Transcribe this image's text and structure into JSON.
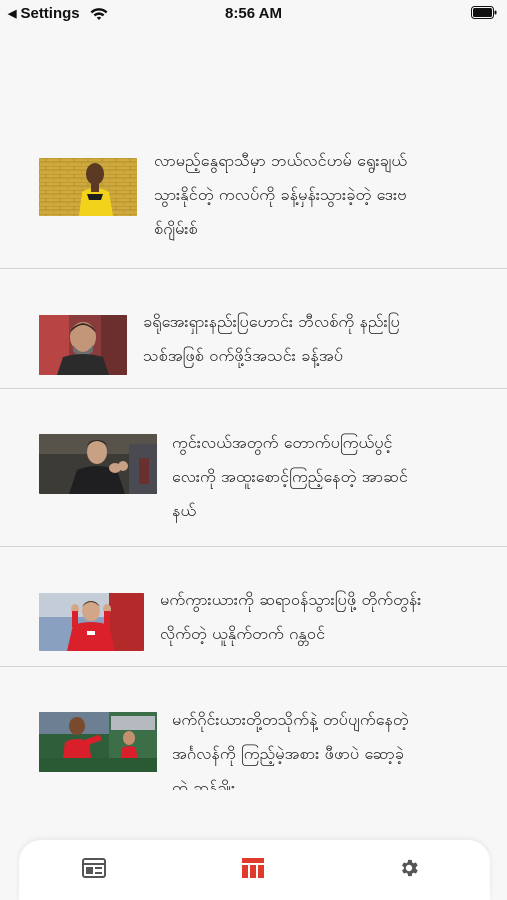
{
  "status_bar": {
    "back_glyph": "◀",
    "back_label": "Settings",
    "time": "8:56 AM",
    "icons": [
      "wifi-icon",
      "battery-icon"
    ]
  },
  "articles": [
    {
      "headline": "လာမည့်နွေရာသီမှာ ဘယ်လင်ဟမ် ရွေးချယ်သွားနိုင်တဲ့ ကလပ်ကို ခန့်မှန်းသွားခဲ့တဲ့ ဒေးဗစ်ဂျိမ်းစ်",
      "lines": [
        "လာမည့်နွေရာသီမှာ ဘယ်လင်ဟမ် ရွေးချယ်",
        "သွားနိုင်တဲ့ ကလပ်ကို ခန့်မှန်းသွားခဲ့တဲ့ ဒေးဗ",
        "စ်ဂျိမ်းစ်"
      ]
    },
    {
      "headline": "ခရိုအေးရှားနည်းပြဟောင်း ဘီလစ်ကို နည်းပြသစ်အဖြစ် ဝက်ဖို့ဒ်အသင်း ခန့်အပ်",
      "lines": [
        "ခရိုအေးရှားနည်းပြဟောင်း ဘီလစ်ကို နည်းပြ",
        "သစ်အဖြစ် ဝက်ဖို့ဒ်အသင်း ခန့်အပ်"
      ]
    },
    {
      "headline": "ကွင်းလယ်အတွက် တောက်ပကြယ်ပွင့်လေးကို အထူးစောင့်ကြည့်နေတဲ့ အာဆင်နယ်",
      "lines": [
        "ကွင်းလယ်အတွက် တောက်ပကြယ်ပွင့်",
        "လေးကို အထူးစောင့်ကြည့်နေတဲ့ အာဆင်",
        "နယ်"
      ]
    },
    {
      "headline": "မက်ကွားယားကို ဆရာဝန်သွားပြဖို့ တိုက်တွန်းလိုက်တဲ့ ယူနိုက်တက် ဂန္တဝင်",
      "lines": [
        "မက်ကွားယားကို ဆရာဝန်သွားပြဖို့ တိုက်တွန်း",
        "လိုက်တဲ့ ယူနိုက်တက် ဂန္တဝင်"
      ]
    },
    {
      "headline": "မက်ဂိုင်းယားတို့တသိုက်နဲ့ တပ်ပျက်နေတဲ့ အင်္ဂလန်ကို ကြည့်မဲ့အစား ဖီဖာပဲ ဆော့ခဲ့ ...",
      "lines": [
        "မက်ဂိုင်းယားတို့တသိုက်နဲ့ တပ်ပျက်နေတဲ့",
        "အင်္ဂလန်ကို ကြည့်မဲ့အစား ဖီဖာပဲ ဆော့ခဲ့",
        "တဲ့ ဆန်ချိုး"
      ]
    }
  ],
  "tab_bar": {
    "tabs": [
      {
        "icon": "news-layout-icon",
        "active": false
      },
      {
        "icon": "table-icon",
        "active": true
      },
      {
        "icon": "gear-icon",
        "active": false
      }
    ],
    "active_color": "#e03a2e",
    "inactive_color": "#555555"
  },
  "colors": {
    "background": "#f7f7f7",
    "divider": "#d4d4d4",
    "text": "#1a1a1a"
  }
}
